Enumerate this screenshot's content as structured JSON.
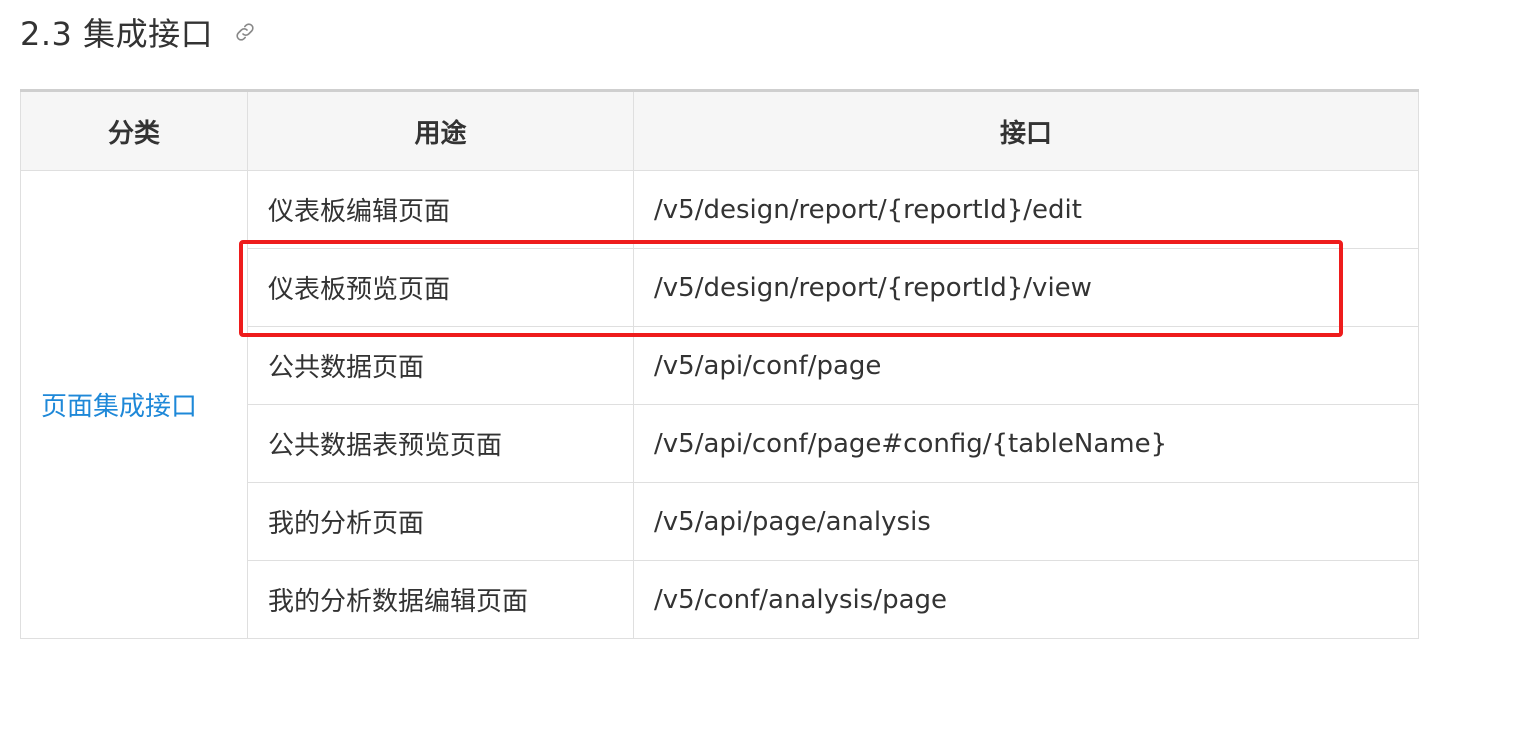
{
  "section": {
    "title": "2.3 集成接口",
    "icon": "link-icon"
  },
  "table": {
    "headers": [
      "分类",
      "用途",
      "接口"
    ],
    "category": "页面集成接口",
    "rows": [
      {
        "purpose": "仪表板编辑页面",
        "endpoint": "/v5/design/report/{reportId}/edit"
      },
      {
        "purpose": "仪表板预览页面",
        "endpoint": "/v5/design/report/{reportId}/view"
      },
      {
        "purpose": "公共数据页面",
        "endpoint": "/v5/api/conf/page"
      },
      {
        "purpose": "公共数据表预览页面",
        "endpoint": "/v5/api/conf/page#config/{tableName}"
      },
      {
        "purpose": "我的分析页面",
        "endpoint": "/v5/api/page/analysis"
      },
      {
        "purpose": "我的分析数据编辑页面",
        "endpoint": "/v5/conf/analysis/page"
      }
    ]
  },
  "annotation": {
    "highlight_color": "#ee1c1c",
    "highlighted_row_index": 1
  },
  "colors": {
    "link": "#1e88d8",
    "header_bg": "#f6f6f6",
    "border": "#dfdfdf"
  }
}
